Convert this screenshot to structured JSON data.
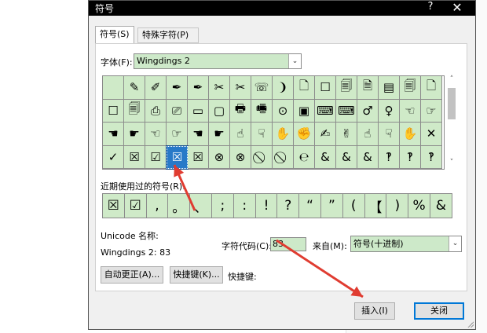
{
  "dialog": {
    "title": "符号",
    "help_label": "?",
    "close_glyph": "✕"
  },
  "tabs": [
    {
      "label": "符号(S)"
    },
    {
      "label": "特殊字符(P)"
    }
  ],
  "font": {
    "label": "字体(F):",
    "value": "Wingdings 2"
  },
  "symbol_grid": {
    "rows": [
      [
        "",
        "✎",
        "✐",
        "✒",
        "✒",
        "✂",
        "✂",
        "☏",
        "❩",
        "🗋",
        "☐",
        "🗐",
        "🗎",
        "▤",
        "🗐",
        "🗋"
      ],
      [
        "☐",
        "🗐",
        "⎙",
        "⎚",
        "▭",
        "▢",
        "🖶",
        "🖷",
        "⊙",
        "▣",
        "⌨",
        "⌨",
        "♂",
        "♀",
        "☜",
        "☞"
      ],
      [
        "☚",
        "☛",
        "☜",
        "☞",
        "☚",
        "☛",
        "☝",
        "☟",
        "✋",
        "✊",
        "✍",
        "✌",
        "☝",
        "☟",
        "✋",
        "✕"
      ],
      [
        "✓",
        "☒",
        "☑",
        "☒",
        "☒",
        "⊗",
        "⊗",
        "⃠",
        "⃠",
        "℮",
        "&",
        "&",
        "&",
        "‽",
        "‽",
        "‽"
      ]
    ],
    "selected": {
      "row": 3,
      "col": 3
    }
  },
  "recent": {
    "label": "近期使用过的符号(R):",
    "symbols": [
      "☒",
      "☑",
      ",",
      "。",
      "、",
      ";",
      ":",
      "!",
      "?",
      "“",
      "”",
      "(",
      "【",
      ")",
      "%",
      "&"
    ]
  },
  "unicode": {
    "name_label": "Unicode 名称:",
    "name_value": "Wingdings 2: 83"
  },
  "char_code": {
    "label": "字符代码(C):",
    "value": "83"
  },
  "from": {
    "label": "来自(M):",
    "value": "符号(十进制)"
  },
  "buttons": {
    "autocorrect": "自动更正(A)...",
    "shortcut_key": "快捷键(K)...",
    "insert": "插入(I)",
    "close": "关闭"
  },
  "shortcut": {
    "label": "快捷键:"
  },
  "annotation_color": "#e03c31",
  "scroll": {
    "up": "˄",
    "down": "˅"
  },
  "dropdown_glyph": "⌄"
}
